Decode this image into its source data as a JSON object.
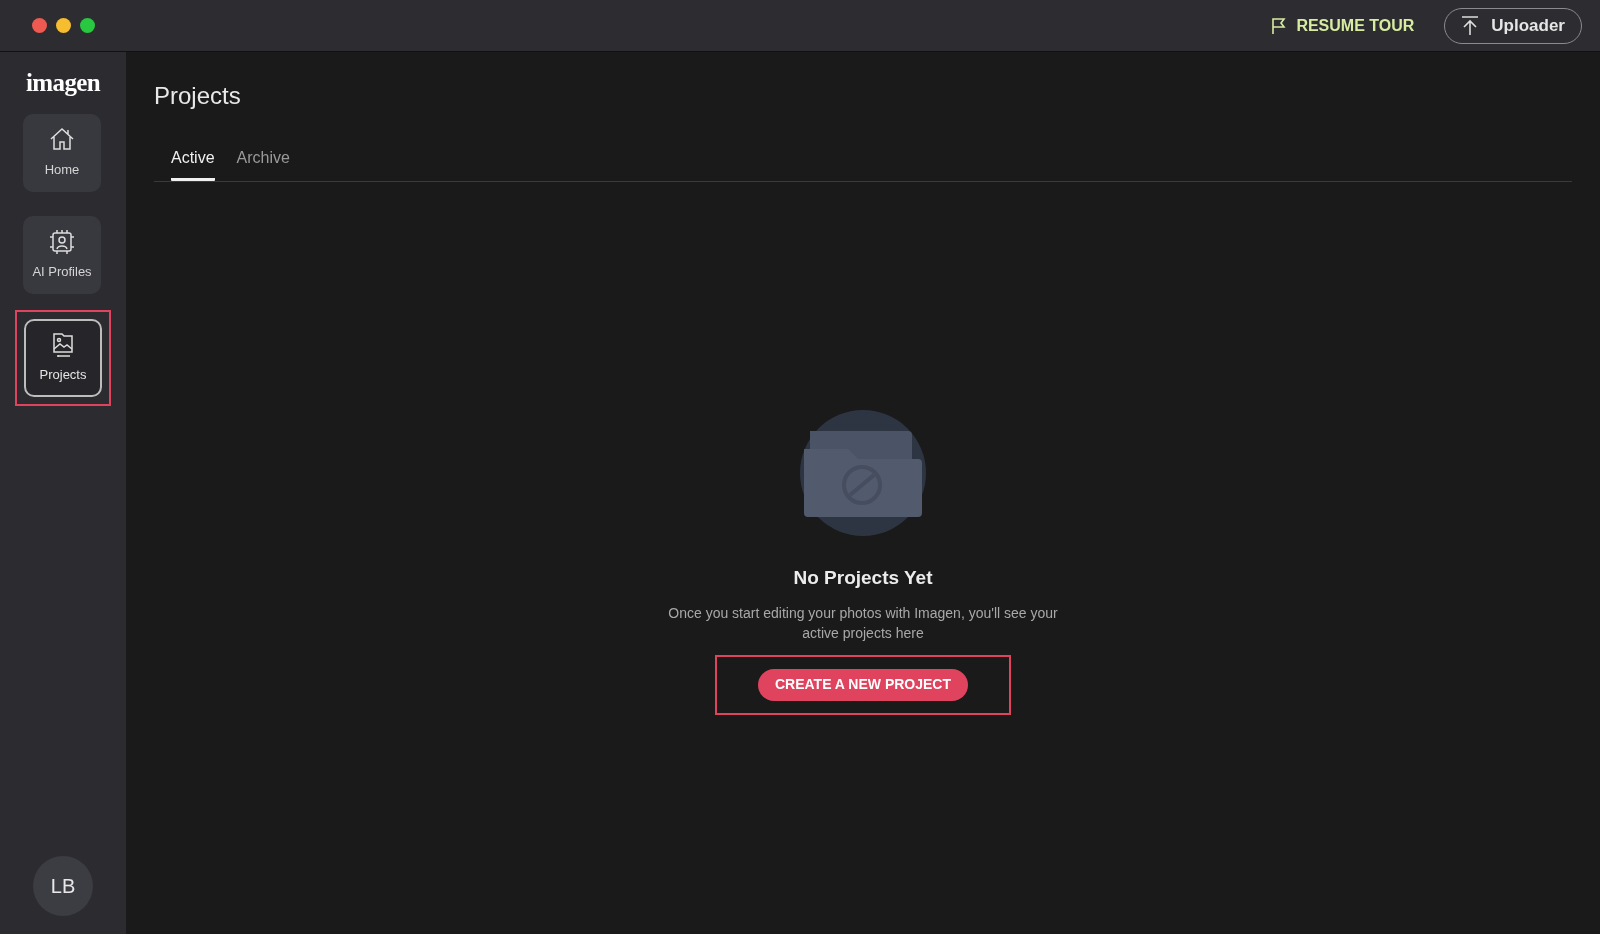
{
  "topbar": {
    "resume_tour": "RESUME TOUR",
    "uploader": "Uploader"
  },
  "sidebar": {
    "logo": "imagen",
    "items": [
      {
        "label": "Home",
        "kind": "home",
        "selected": false,
        "highlighted": false
      },
      {
        "label": "AI Profiles",
        "kind": "profiles",
        "selected": false,
        "highlighted": false
      },
      {
        "label": "Projects",
        "kind": "projects",
        "selected": true,
        "highlighted": true
      }
    ],
    "avatar": "LB"
  },
  "page": {
    "title": "Projects",
    "tabs": [
      {
        "label": "Active",
        "selected": true
      },
      {
        "label": "Archive",
        "selected": false
      }
    ]
  },
  "empty_state": {
    "title": "No Projects Yet",
    "description": "Once you start editing your photos with Imagen, you'll see your active projects here",
    "button": "CREATE A NEW PROJECT",
    "button_highlighted": true
  }
}
